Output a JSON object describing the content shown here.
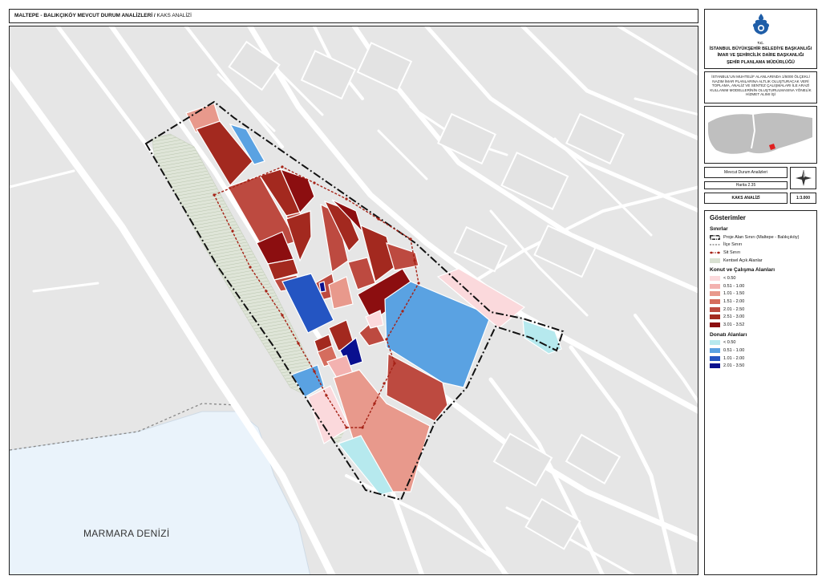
{
  "header": {
    "title_bold": "MALTEPE - BALIKÇIKÖY MEVCUT DURUM ANALİZLERİ /",
    "title_rest": " KAKS ANALİZİ"
  },
  "org": {
    "tc": "T.C.",
    "line1": "İSTANBUL BÜYÜKŞEHİR BELEDİYE BAŞKANLIĞI",
    "line2": "İMAR VE ŞEHİRCİLİK DAİRE BAŞKANLIĞI",
    "line3": "ŞEHİR PLANLAMA MÜDÜRLÜĞÜ"
  },
  "project_description": "İSTANBUL'UN MUHTELİF ALANLARINDA 1/5000 ÖLÇEKLİ NAZIM İMAR PLANLARINA ALTLIK OLUŞTURACAK VERİ TOPLAMA, ANALİZ VE SENTEZ ÇALIŞMALARI İLE ARAZİ KULLANIM MODELLERİNİN OLUŞTURULMASINA YÖNELİK HİZMET ALIMI İŞİ",
  "info": {
    "analysis_type": "Mevcut Durum Analizleri",
    "map_no": "Harita 2.35",
    "map_name": "KAKS ANALİZİ",
    "scale": "1:3.000"
  },
  "map": {
    "sea_label": "MARMARA DENİZİ"
  },
  "colors": {
    "konut": [
      "#fbd9dc",
      "#f3b2b0",
      "#e8998c",
      "#d56d5e",
      "#bd4a40",
      "#a3291f",
      "#8c0e10"
    ],
    "donati": [
      "#b6e9ee",
      "#5aa2e2",
      "#2455c2",
      "#09108f"
    ],
    "kentsel": "#d9e1d2",
    "sit": "#a62216"
  },
  "legend": {
    "title": "Gösterimler",
    "sinirlar_title": "Sınırlar",
    "sinirlar": [
      {
        "label": "Proje Alan Sınırı (Maltepe - Balıkçıköy)",
        "style": "project"
      },
      {
        "label": "İlçe Sınırı",
        "style": "ilce"
      },
      {
        "label": "Sit Sınırı",
        "style": "sit"
      },
      {
        "label": "Kentsel Açık Alanlar",
        "style": "kentsel"
      }
    ],
    "konut_title": "Konut ve Çalışma Alanları",
    "konut": [
      "< 0.50",
      "0.51 - 1.00",
      "1.01 - 1.50",
      "1.51 - 2.00",
      "2.01 - 2.50",
      "2.51 - 3.00",
      "3.01 - 3.52"
    ],
    "donati_title": "Donatı Alanları",
    "donati": [
      "< 0.50",
      "0.51 - 1.00",
      "1.01 - 2.00",
      "2.01 - 3.50"
    ]
  }
}
